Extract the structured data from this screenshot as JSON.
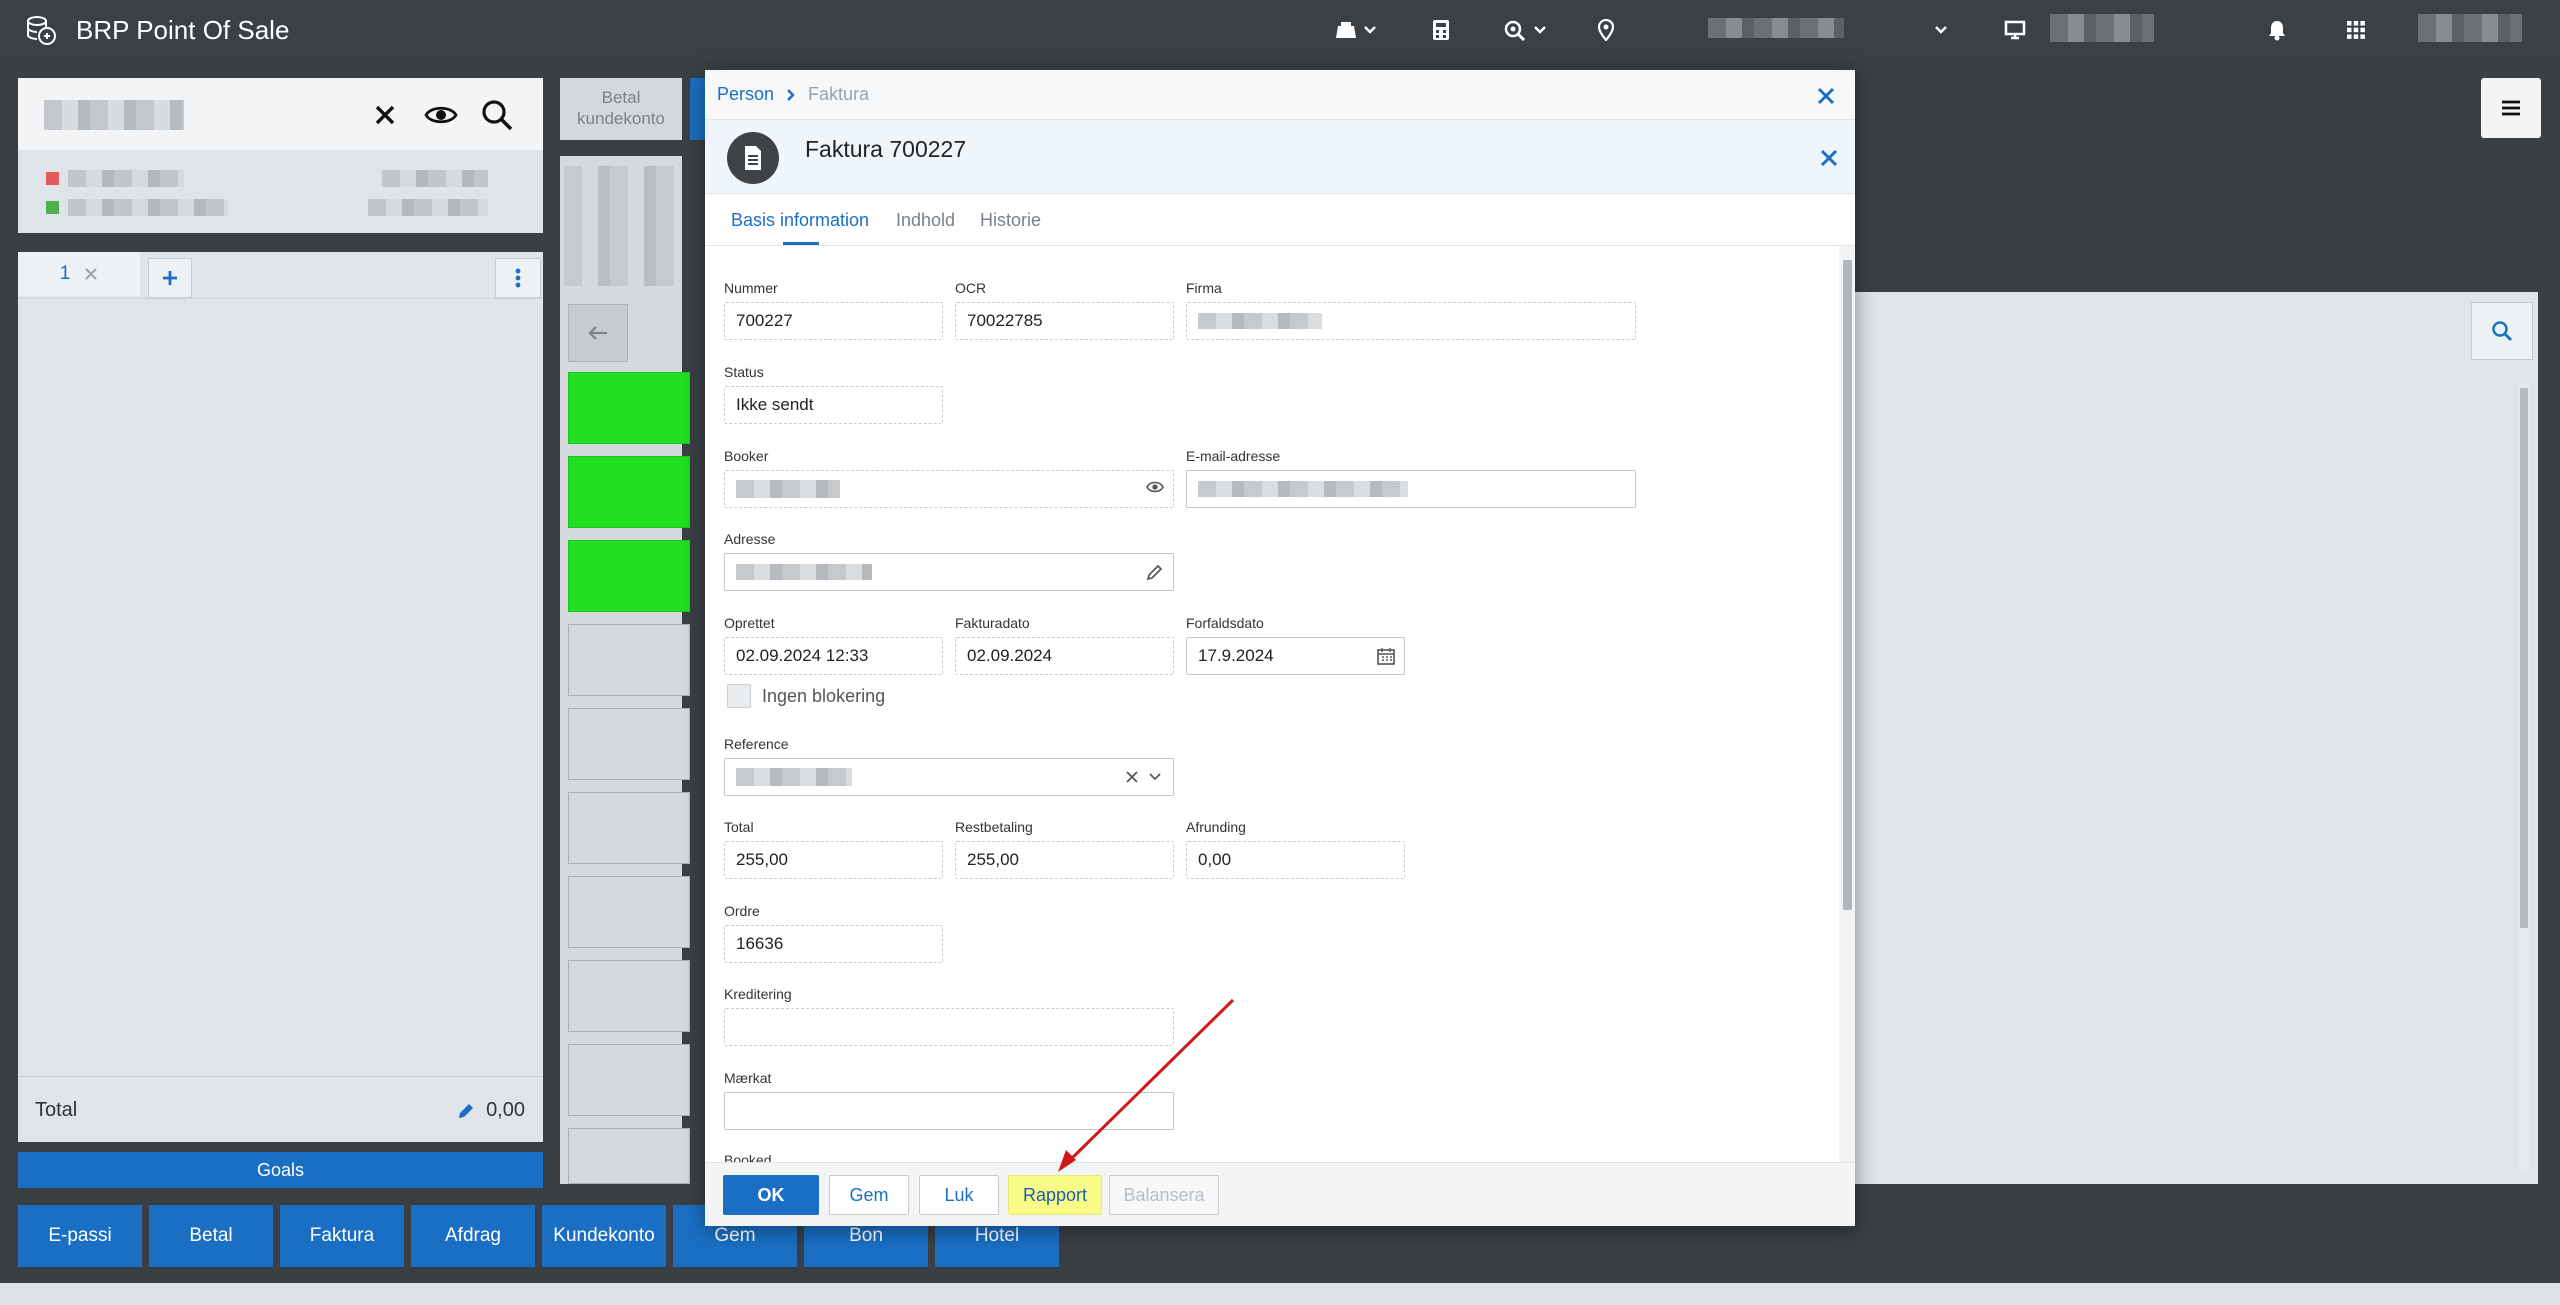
{
  "app": {
    "title": "BRP Point Of Sale"
  },
  "left": {
    "tab_label": "1",
    "total_label": "Total",
    "total_value": "0,00",
    "goals_label": "Goals"
  },
  "bottom_buttons": [
    "E-passi",
    "Betal",
    "Faktura",
    "Afdrag",
    "Kundekonto",
    "Gem",
    "Bon",
    "Hotel"
  ],
  "mid": {
    "betal_tab": "Betal kundekonto"
  },
  "dialog": {
    "breadcrumb": [
      "Person",
      "Faktura"
    ],
    "title": "Faktura 700227",
    "tabs": [
      "Basis information",
      "Indhold",
      "Historie"
    ],
    "fields": {
      "nummer": {
        "label": "Nummer",
        "value": "700227"
      },
      "ocr": {
        "label": "OCR",
        "value": "70022785"
      },
      "firma": {
        "label": "Firma"
      },
      "status": {
        "label": "Status",
        "value": "Ikke sendt"
      },
      "booker": {
        "label": "Booker"
      },
      "email": {
        "label": "E-mail-adresse"
      },
      "adresse": {
        "label": "Adresse"
      },
      "oprettet": {
        "label": "Oprettet",
        "value": "02.09.2024 12:33"
      },
      "fakturadato": {
        "label": "Fakturadato",
        "value": "02.09.2024"
      },
      "forfaldsdato": {
        "label": "Forfaldsdato",
        "value": "17.9.2024"
      },
      "ingen_blokering": {
        "label": "Ingen blokering"
      },
      "reference": {
        "label": "Reference"
      },
      "total": {
        "label": "Total",
        "value": "255,00"
      },
      "restbetaling": {
        "label": "Restbetaling",
        "value": "255,00"
      },
      "afrunding": {
        "label": "Afrunding",
        "value": "0,00"
      },
      "ordre": {
        "label": "Ordre",
        "value": "16636"
      },
      "kreditering": {
        "label": "Kreditering"
      },
      "maerkat": {
        "label": "Mærkat"
      },
      "booked": {
        "label": "Booked"
      }
    },
    "footer": {
      "ok": "OK",
      "gem": "Gem",
      "luk": "Luk",
      "rapport": "Rapport",
      "balansera": "Balansera"
    }
  },
  "colors": {
    "accent": "#1a6fc4",
    "topbar": "#3b4045",
    "highlight": "#f9fb88",
    "green_tile": "#21df21",
    "arrow": "#d01818"
  }
}
